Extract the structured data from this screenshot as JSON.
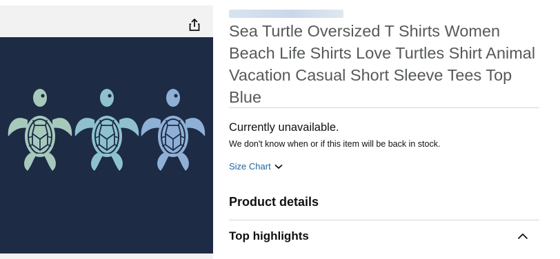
{
  "product": {
    "title": "Sea Turtle Oversized T Shirts Women Beach Life Shirts Love Turtles Shirt Animal Vacation Casual Short Sleeve Tees Top Blue"
  },
  "availability": {
    "status": "Currently unavailable.",
    "note": "We don't know when or if this item will be back in stock."
  },
  "size_chart": {
    "label": "Size Chart"
  },
  "sections": {
    "product_details": "Product details",
    "top_highlights": "Top highlights"
  },
  "colors": {
    "shirt_background": "#1d2b45",
    "link": "#2162a1",
    "title_text": "#565959"
  },
  "icons": {
    "share": "share-icon",
    "size_chart_toggle": "chevron-down-icon",
    "highlights_toggle": "chevron-up-icon"
  }
}
